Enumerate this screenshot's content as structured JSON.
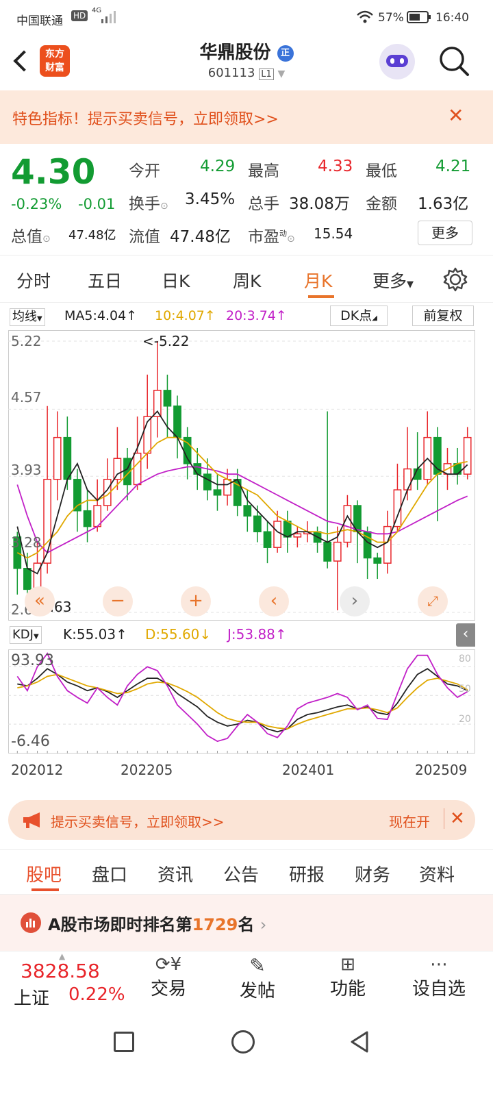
{
  "status_bar": {
    "carrier": "中国联通",
    "hd": "HD",
    "net": "4G",
    "battery": "57%",
    "time": "16:40"
  },
  "header": {
    "logo_line1": "东方",
    "logo_line2": "财富",
    "title": "华鼎股份",
    "badge": "正",
    "code": "601113",
    "level": "L1"
  },
  "banner": {
    "text": "特色指标！提示买卖信号，立即领取>>",
    "close": "✕"
  },
  "quote": {
    "price": "4.30",
    "change_pct": "-0.23%",
    "change": "-0.01",
    "open_label": "今开",
    "open": "4.29",
    "high_label": "最高",
    "high": "4.33",
    "low_label": "最低",
    "low": "4.21",
    "turnover_label": "换手",
    "turnover": "3.45%",
    "volume_label": "总手",
    "volume": "38.08万",
    "amount_label": "金额",
    "amount": "1.63亿",
    "mktcap_label": "总值",
    "mktcap": "47.48亿",
    "float_label": "流值",
    "float": "47.48亿",
    "pe_label": "市盈",
    "pe_sup": "动",
    "pe": "15.54",
    "more": "更多"
  },
  "tabs": [
    "分时",
    "五日",
    "日K",
    "周K",
    "月K",
    "更多"
  ],
  "active_tab": 4,
  "ma_bar": {
    "selector": "均线",
    "ma5": "MA5:4.04",
    "ma10": "10:4.07",
    "ma20": "20:3.74",
    "dk": "DK点",
    "adjust": "前复权"
  },
  "kdj_bar": {
    "selector": "KDJ",
    "k": "K:55.03",
    "d": "D:55.60",
    "j": "J:53.88"
  },
  "colors": {
    "up": "#e8252a",
    "down": "#129b32",
    "ma5": "#222222",
    "ma10": "#e0a800",
    "ma20": "#c11fc7",
    "accent": "#e8742b"
  },
  "chart_data": [
    {
      "type": "candlestick",
      "title": "",
      "y_ticks": [
        "5.22",
        "4.57",
        "3.93",
        "3.28",
        "2.63"
      ],
      "ylim": [
        2.63,
        5.22
      ],
      "max_label": "<-5.22",
      "min_label": "<-2.63",
      "ma5_values": [
        3.45,
        3.05,
        3.0,
        3.2,
        3.55,
        3.9,
        4.05,
        3.8,
        3.7,
        3.8,
        3.95,
        4.0,
        4.2,
        4.45,
        4.55,
        4.4,
        4.3,
        4.1,
        3.95,
        3.9,
        3.85,
        3.85,
        3.9,
        3.7,
        3.6,
        3.5,
        3.4,
        3.35,
        3.4,
        3.4,
        3.35,
        3.3,
        3.35,
        3.55,
        3.4,
        3.3,
        3.25,
        3.3,
        3.55,
        3.8,
        4.0,
        4.1,
        4.0,
        3.95,
        3.95,
        4.04
      ],
      "ma10_values": [
        3.2,
        3.15,
        3.2,
        3.3,
        3.4,
        3.55,
        3.65,
        3.7,
        3.7,
        3.75,
        3.85,
        3.95,
        4.05,
        4.15,
        4.25,
        4.3,
        4.3,
        4.25,
        4.15,
        4.05,
        3.95,
        3.9,
        3.85,
        3.8,
        3.75,
        3.65,
        3.55,
        3.5,
        3.45,
        3.4,
        3.4,
        3.38,
        3.4,
        3.42,
        3.4,
        3.35,
        3.3,
        3.3,
        3.4,
        3.55,
        3.7,
        3.85,
        3.95,
        4.0,
        4.05,
        4.07
      ],
      "ma20_values": [
        3.85,
        3.55,
        3.3,
        3.2,
        3.25,
        3.3,
        3.35,
        3.4,
        3.45,
        3.55,
        3.65,
        3.75,
        3.85,
        3.9,
        3.95,
        3.98,
        4.0,
        4.02,
        4.02,
        4.0,
        3.98,
        3.95,
        3.95,
        3.9,
        3.85,
        3.8,
        3.75,
        3.7,
        3.65,
        3.6,
        3.55,
        3.5,
        3.48,
        3.45,
        3.42,
        3.4,
        3.38,
        3.38,
        3.4,
        3.45,
        3.5,
        3.55,
        3.6,
        3.65,
        3.7,
        3.74
      ],
      "candles": [
        [
          3.35,
          3.05,
          3.4,
          2.8
        ],
        [
          3.05,
          2.85,
          3.2,
          2.7
        ],
        [
          2.85,
          3.1,
          3.3,
          2.8
        ],
        [
          3.1,
          3.9,
          4.6,
          3.0
        ],
        [
          3.9,
          4.3,
          4.55,
          3.7
        ],
        [
          4.3,
          3.9,
          4.5,
          3.8
        ],
        [
          3.9,
          3.6,
          4.0,
          3.4
        ],
        [
          3.6,
          3.45,
          3.8,
          3.3
        ],
        [
          3.45,
          3.65,
          3.9,
          3.4
        ],
        [
          3.65,
          3.9,
          4.1,
          3.6
        ],
        [
          3.9,
          4.1,
          4.4,
          3.8
        ],
        [
          4.1,
          3.85,
          4.2,
          3.7
        ],
        [
          3.85,
          4.15,
          4.5,
          3.8
        ],
        [
          4.15,
          4.5,
          4.9,
          4.0
        ],
        [
          4.5,
          4.75,
          5.22,
          4.3
        ],
        [
          4.75,
          4.6,
          4.9,
          4.3
        ],
        [
          4.6,
          4.3,
          4.7,
          4.1
        ],
        [
          4.3,
          4.05,
          4.4,
          3.9
        ],
        [
          4.05,
          3.95,
          4.2,
          3.8
        ],
        [
          3.95,
          3.8,
          4.1,
          3.7
        ],
        [
          3.8,
          3.75,
          3.95,
          3.6
        ],
        [
          3.75,
          3.9,
          4.0,
          3.65
        ],
        [
          3.9,
          3.65,
          4.0,
          3.55
        ],
        [
          3.65,
          3.55,
          3.8,
          3.4
        ],
        [
          3.55,
          3.4,
          3.65,
          3.3
        ],
        [
          3.4,
          3.25,
          3.5,
          3.1
        ],
        [
          3.25,
          3.5,
          3.6,
          3.2
        ],
        [
          3.5,
          3.35,
          3.6,
          3.2
        ],
        [
          3.35,
          3.38,
          3.45,
          3.25
        ],
        [
          3.38,
          3.4,
          3.5,
          3.3
        ],
        [
          3.4,
          3.3,
          3.45,
          3.2
        ],
        [
          3.3,
          3.12,
          4.55,
          3.05
        ],
        [
          3.12,
          3.3,
          3.45,
          2.65
        ],
        [
          3.3,
          3.65,
          3.75,
          3.25
        ],
        [
          3.65,
          3.4,
          3.7,
          3.1
        ],
        [
          3.4,
          3.15,
          3.45,
          2.95
        ],
        [
          3.15,
          3.1,
          3.2,
          2.95
        ],
        [
          3.1,
          3.45,
          3.6,
          3.0
        ],
        [
          3.45,
          3.8,
          4.05,
          3.4
        ],
        [
          3.8,
          4.0,
          4.4,
          3.7
        ],
        [
          4.0,
          3.9,
          4.35,
          3.8
        ],
        [
          3.9,
          4.3,
          4.55,
          3.85
        ],
        [
          4.3,
          3.95,
          4.4,
          3.5
        ],
        [
          3.95,
          4.05,
          4.2,
          3.8
        ],
        [
          4.05,
          3.95,
          4.2,
          3.85
        ],
        [
          3.95,
          4.3,
          4.4,
          3.9
        ]
      ]
    },
    {
      "type": "line",
      "title": "",
      "y_ticks_left": [
        "93.93",
        "-6.46"
      ],
      "y_ticks_right": [
        "80",
        "50",
        "20"
      ],
      "ylim": [
        -6.46,
        93.93
      ],
      "x_labels": [
        "202012",
        "202205",
        "202401",
        "202509"
      ],
      "series": [
        {
          "name": "K",
          "values": [
            62,
            60,
            68,
            78,
            72,
            64,
            60,
            55,
            58,
            54,
            48,
            55,
            62,
            68,
            68,
            62,
            52,
            45,
            38,
            28,
            22,
            18,
            20,
            24,
            22,
            15,
            12,
            15,
            25,
            30,
            32,
            35,
            38,
            40,
            36,
            38,
            32,
            30,
            42,
            58,
            72,
            78,
            70,
            62,
            60,
            55
          ]
        },
        {
          "name": "D",
          "values": [
            58,
            60,
            64,
            70,
            72,
            68,
            64,
            60,
            58,
            55,
            52,
            53,
            57,
            62,
            64,
            63,
            59,
            54,
            48,
            40,
            32,
            26,
            23,
            22,
            22,
            18,
            16,
            15,
            20,
            24,
            27,
            30,
            33,
            36,
            36,
            37,
            35,
            32,
            37,
            48,
            58,
            66,
            68,
            65,
            62,
            56
          ]
        },
        {
          "name": "J",
          "values": [
            70,
            55,
            80,
            94,
            70,
            55,
            48,
            42,
            58,
            48,
            40,
            60,
            72,
            80,
            76,
            60,
            40,
            30,
            20,
            8,
            2,
            5,
            18,
            30,
            22,
            10,
            6,
            18,
            36,
            42,
            45,
            48,
            52,
            48,
            35,
            40,
            26,
            25,
            52,
            78,
            92,
            92,
            72,
            58,
            48,
            54
          ]
        }
      ]
    }
  ],
  "bottom_banner": {
    "text": "提示买卖信号，立即领取>>",
    "cta": "现在开",
    "close": "✕"
  },
  "sub_tabs": [
    "股吧",
    "盘口",
    "资讯",
    "公告",
    "研报",
    "财务",
    "资料"
  ],
  "rank": {
    "prefix": "A股市场即时排名第",
    "rank": "1729",
    "suffix": "名"
  },
  "footer": {
    "index_value": "3828.58",
    "index_name": "上证",
    "index_change": "0.22%",
    "items": [
      "交易",
      "发帖",
      "功能",
      "设自选"
    ]
  }
}
